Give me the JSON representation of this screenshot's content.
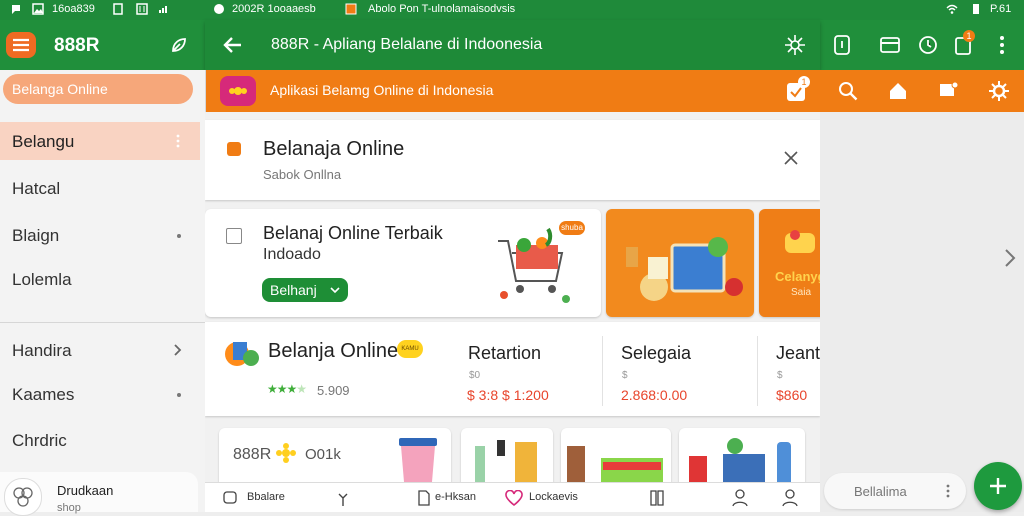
{
  "status_bar": {
    "left_text_1": "16oa839",
    "left_text_2": "2002R 1ooaaesb",
    "left_text_3": "Abolo Pon T-ulnolamaisodvsis",
    "right_text": "P.61",
    "icons": [
      "chat-icon",
      "image-icon",
      "doc-icon",
      "bars-icon",
      "alert-icon",
      "wifi-icon",
      "battery-icon"
    ]
  },
  "app_bar": {
    "brand": "888R",
    "title": "888R - Apliang Belalane di Indoonesia",
    "colors": {
      "green": "#208f3b",
      "orange": "#f07c14"
    }
  },
  "orange_bar": {
    "subtitle": "Aplikasi Belamg Online di Indonesia",
    "badge_count": "1"
  },
  "drawer": {
    "search_pill": "Belanga Online",
    "items": [
      {
        "label": "Belangu",
        "selected": true
      },
      {
        "label": "Hatcal"
      },
      {
        "label": "Blaign"
      },
      {
        "label": "Lolemla"
      },
      {
        "label": "Handira"
      },
      {
        "label": "Kaames"
      },
      {
        "label": "Chrdric"
      }
    ],
    "account": {
      "name": "Drudkaan",
      "sub": "shop"
    }
  },
  "header_card": {
    "title": "Belanaja Online",
    "subtitle": "Sabok Onllna"
  },
  "promo": {
    "title": "Belanaj Online Terbaik",
    "title2": "Indoado",
    "button": "Belhanj",
    "tag": "shuba",
    "banner2_text": "Celanyg",
    "banner2_sub": "Saia"
  },
  "product_row": {
    "shop_name": "Belanja Online",
    "shop_badge": "KAMU",
    "rating_text": "5.909",
    "cols": [
      {
        "title": "Retartion",
        "sub": "$0",
        "price": "$ 3:8 $ 1:200"
      },
      {
        "title": "Selegaia",
        "sub": "$",
        "price": "2.868:0.00"
      },
      {
        "title": "Jeant",
        "sub": "$",
        "price": "$860"
      }
    ]
  },
  "bottom_cards": {
    "card1_text": "888R",
    "card1_text2": "O01k"
  },
  "bottom_nav": [
    {
      "label": "Bbalare"
    },
    {
      "label": ""
    },
    {
      "label": "e-Hksan"
    },
    {
      "label": "Lockaevis"
    },
    {
      "label": ""
    },
    {
      "label": ""
    },
    {
      "label": ""
    }
  ],
  "right_area": {
    "search_pill": "Bellalima"
  }
}
